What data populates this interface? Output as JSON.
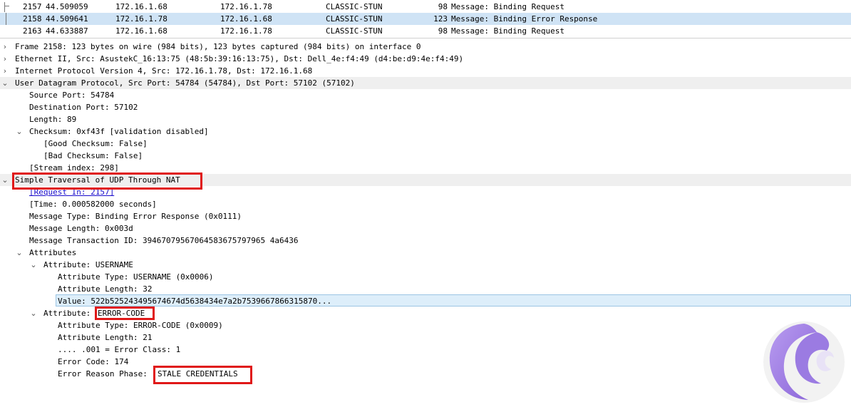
{
  "packets": [
    {
      "no": "2157",
      "time": "44.509059",
      "src": "172.16.1.68",
      "dst": "172.16.1.78",
      "proto": "CLASSIC-STUN",
      "len": "98",
      "info": "Message: Binding Request"
    },
    {
      "no": "2158",
      "time": "44.509641",
      "src": "172.16.1.78",
      "dst": "172.16.1.68",
      "proto": "CLASSIC-STUN",
      "len": "123",
      "info": "Message: Binding Error Response"
    },
    {
      "no": "2163",
      "time": "44.633887",
      "src": "172.16.1.68",
      "dst": "172.16.1.78",
      "proto": "CLASSIC-STUN",
      "len": "98",
      "info": "Message: Binding Request"
    }
  ],
  "tree": {
    "frame": "Frame 2158: 123 bytes on wire (984 bits), 123 bytes captured (984 bits) on interface 0",
    "ethernet": "Ethernet II, Src: AsustekC_16:13:75 (48:5b:39:16:13:75), Dst: Dell_4e:f4:49 (d4:be:d9:4e:f4:49)",
    "ip": "Internet Protocol Version 4, Src: 172.16.1.78, Dst: 172.16.1.68",
    "udp": "User Datagram Protocol, Src Port: 54784 (54784), Dst Port: 57102 (57102)",
    "src_port": "Source Port: 54784",
    "dst_port": "Destination Port: 57102",
    "length": "Length: 89",
    "checksum": "Checksum: 0xf43f [validation disabled]",
    "good_checksum": "[Good Checksum: False]",
    "bad_checksum": "[Bad Checksum: False]",
    "stream_index": "[Stream index: 298]",
    "stun": "Simple Traversal of UDP Through NAT",
    "request_in": "[Request In: 2157]",
    "time": "[Time: 0.000582000 seconds]",
    "msg_type": "Message Type: Binding Error Response (0x0111)",
    "msg_length": "Message Length: 0x003d",
    "msg_txid": "Message Transaction ID: 39467079567064583675797965 4a6436",
    "attributes": "Attributes",
    "attr_username": "Attribute: USERNAME",
    "attr_type_user": "Attribute Type: USERNAME (0x0006)",
    "attr_len_user": "Attribute Length: 32",
    "value": "Value: 522b525243495674674d5638434e7a2b7539667866315870...",
    "attr_prefix": "Attribute: ",
    "attr_error": "ERROR-CODE",
    "attr_type_err": "Attribute Type: ERROR-CODE (0x0009)",
    "attr_len_err": "Attribute Length: 21",
    "error_class": ".... .001 = Error Class: 1",
    "error_code": "Error Code: 174",
    "reason_prefix": "Error Reason Phase: ",
    "reason": "STALE CREDENTIALS"
  },
  "colors": {
    "highlight": "#e01818",
    "selected_row": "#cfe3f5",
    "link": "#1a0dcc"
  },
  "icons": [
    "collapsed-arrow-icon",
    "expanded-arrow-icon",
    "logo-icon"
  ]
}
